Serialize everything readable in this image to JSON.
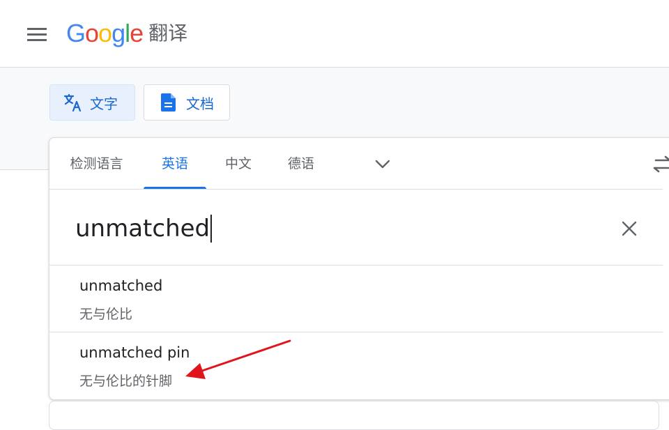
{
  "header": {
    "logo_letters": [
      "G",
      "o",
      "o",
      "g",
      "l",
      "e"
    ],
    "product_name": "翻译"
  },
  "modes": {
    "text_label": "文字",
    "document_label": "文档"
  },
  "language_bar": {
    "tabs": [
      {
        "label": "检测语言",
        "active": false
      },
      {
        "label": "英语",
        "active": true
      },
      {
        "label": "中文",
        "active": false
      },
      {
        "label": "德语",
        "active": false
      }
    ]
  },
  "input": {
    "value": "unmatched"
  },
  "suggestions": [
    {
      "term": "unmatched",
      "translation": "无与伦比"
    },
    {
      "term": "unmatched pin",
      "translation": "无与伦比的针脚"
    }
  ],
  "colors": {
    "accent": "#1a73e8",
    "annotation_arrow": "#e0151b"
  },
  "icons": {
    "menu": "hamburger-menu-icon",
    "text_mode": "translate-icon",
    "document_mode": "document-icon",
    "more_languages": "chevron-down-icon",
    "swap": "swap-arrows-icon",
    "clear": "close-icon"
  }
}
